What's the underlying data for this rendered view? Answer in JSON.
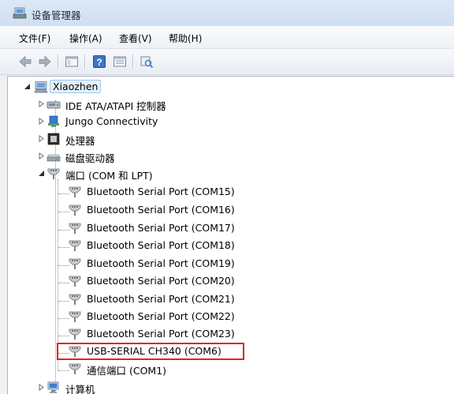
{
  "window": {
    "title": "设备管理器"
  },
  "menu": {
    "items": [
      "文件(F)",
      "操作(A)",
      "查看(V)",
      "帮助(H)"
    ]
  },
  "tree": {
    "root": "Xiaozhen",
    "categories": [
      {
        "label": "IDE ATA/ATAPI 控制器",
        "icon": "ide-controller-icon",
        "expanded": false
      },
      {
        "label": "Jungo Connectivity",
        "icon": "jungo-device-icon",
        "expanded": false
      },
      {
        "label": "处理器",
        "icon": "processor-icon",
        "expanded": false
      },
      {
        "label": "磁盘驱动器",
        "icon": "disk-drive-icon",
        "expanded": false
      },
      {
        "label": "端口 (COM 和 LPT)",
        "icon": "port-icon",
        "expanded": true
      },
      {
        "label": "计算机",
        "icon": "computer-icon",
        "expanded": false
      }
    ],
    "ports": [
      "Bluetooth Serial Port (COM15)",
      "Bluetooth Serial Port (COM16)",
      "Bluetooth Serial Port (COM17)",
      "Bluetooth Serial Port (COM18)",
      "Bluetooth Serial Port (COM19)",
      "Bluetooth Serial Port (COM20)",
      "Bluetooth Serial Port (COM21)",
      "Bluetooth Serial Port (COM22)",
      "Bluetooth Serial Port (COM23)",
      "USB-SERIAL CH340 (COM6)",
      "通信端口 (COM1)"
    ],
    "highlighted_port": "USB-SERIAL CH340 (COM6)"
  },
  "colors": {
    "highlight_border": "#e4231b",
    "selection_fill": "#e6f0fb"
  }
}
